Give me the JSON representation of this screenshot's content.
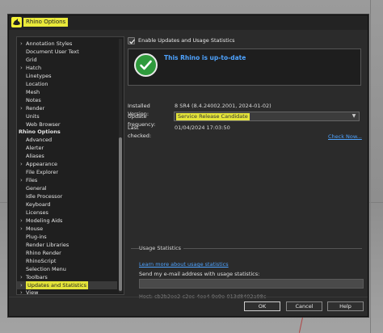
{
  "window": {
    "title": "Rhino Options",
    "icon": "rhino-logo-icon"
  },
  "tree": {
    "items": [
      {
        "label": "Annotation Styles",
        "expandable": true,
        "level": 1
      },
      {
        "label": "Document User Text",
        "expandable": false,
        "level": 1
      },
      {
        "label": "Grid",
        "expandable": false,
        "level": 1
      },
      {
        "label": "Hatch",
        "expandable": true,
        "level": 1
      },
      {
        "label": "Linetypes",
        "expandable": false,
        "level": 1
      },
      {
        "label": "Location",
        "expandable": false,
        "level": 1
      },
      {
        "label": "Mesh",
        "expandable": false,
        "level": 1
      },
      {
        "label": "Notes",
        "expandable": false,
        "level": 1
      },
      {
        "label": "Render",
        "expandable": true,
        "level": 1
      },
      {
        "label": "Units",
        "expandable": false,
        "level": 1
      },
      {
        "label": "Web Browser",
        "expandable": false,
        "level": 1
      },
      {
        "label": "Rhino Options",
        "expandable": false,
        "level": 0,
        "header": true
      },
      {
        "label": "Advanced",
        "expandable": false,
        "level": 1
      },
      {
        "label": "Alerter",
        "expandable": false,
        "level": 1
      },
      {
        "label": "Aliases",
        "expandable": false,
        "level": 1
      },
      {
        "label": "Appearance",
        "expandable": true,
        "level": 1
      },
      {
        "label": "File Explorer",
        "expandable": false,
        "level": 1
      },
      {
        "label": "Files",
        "expandable": true,
        "level": 1
      },
      {
        "label": "General",
        "expandable": false,
        "level": 1
      },
      {
        "label": "Idle Processor",
        "expandable": false,
        "level": 1
      },
      {
        "label": "Keyboard",
        "expandable": false,
        "level": 1
      },
      {
        "label": "Licenses",
        "expandable": false,
        "level": 1
      },
      {
        "label": "Modeling Aids",
        "expandable": true,
        "level": 1
      },
      {
        "label": "Mouse",
        "expandable": true,
        "level": 1
      },
      {
        "label": "Plug-ins",
        "expandable": false,
        "level": 1
      },
      {
        "label": "Render Libraries",
        "expandable": false,
        "level": 1
      },
      {
        "label": "Rhino Render",
        "expandable": false,
        "level": 1
      },
      {
        "label": "RhinoScript",
        "expandable": false,
        "level": 1
      },
      {
        "label": "Selection Menu",
        "expandable": false,
        "level": 1
      },
      {
        "label": "Toolbars",
        "expandable": true,
        "level": 1
      },
      {
        "label": "Updates and Statistics",
        "expandable": true,
        "level": 1,
        "selected": true
      },
      {
        "label": "View",
        "expandable": true,
        "level": 1
      }
    ]
  },
  "updates": {
    "enable_label": "Enable Updates and Usage Statistics",
    "enabled": true,
    "status_text": "This Rhino is up-to-date",
    "installed_version_label": "Installed Version:",
    "installed_version_value": "8 SR4 (8.4.24002.2001, 2024-01-02)",
    "update_frequency_label": "Update frequency:",
    "update_frequency_value": "Service Release Candidate",
    "last_checked_label": "Last checked:",
    "last_checked_value": "01/04/2024 17:03:50",
    "check_now_link": "Check Now..."
  },
  "usage": {
    "section_title": "Usage Statistics",
    "learn_more_link": "Learn more about usage statistics",
    "email_label": "Send my e-mail address with usage statistics:",
    "email_value": "",
    "host_text": "Host: cb2b2ee2-c2ec-4ee4-9e9e-013d8402a98c"
  },
  "footer": {
    "ok_label": "OK",
    "cancel_label": "Cancel",
    "help_label": "Help"
  },
  "colors": {
    "highlight": "#e4e43a",
    "link": "#4ea3ff",
    "status_green": "#2f9a3c"
  }
}
